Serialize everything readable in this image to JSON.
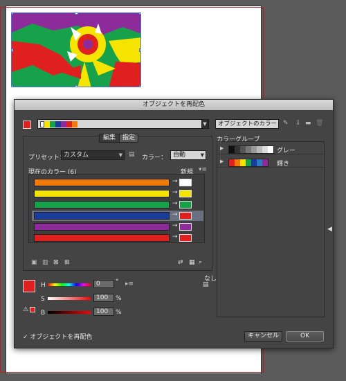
{
  "dialog": {
    "title": "オブジェクトを再配色",
    "color_group_name": "オブジェクトのカラー",
    "color_group_strip": [
      "#ffffff",
      "#f5e400",
      "#17a14a",
      "#1a3c9a",
      "#8e2b9a",
      "#e0201f",
      "#f07a0a"
    ],
    "tabs": {
      "edit": "編集",
      "assign": "指定"
    },
    "preset_label": "プリセット：",
    "preset_value": "カスタム",
    "colors_label": "カラー：",
    "colors_value": "自動",
    "current_colors_label": "現在のカラー (6)",
    "new_label": "新規",
    "rows": [
      {
        "current": "#f07a0a",
        "new": "#ffffff",
        "arrow": "→"
      },
      {
        "current": "#f5e400",
        "new": "#f5e400",
        "arrow": "→"
      },
      {
        "current": "#17a14a",
        "new": "#17a14a",
        "arrow": "→"
      },
      {
        "current": "#1a3c9a",
        "new": "#e0201f",
        "arrow": "→"
      },
      {
        "current": "#8e2b9a",
        "new": "#8e2b9a",
        "arrow": "→"
      },
      {
        "current": "#e0201f",
        "new": "#e0201f",
        "arrow": "→"
      }
    ],
    "color_groups_label": "カラーグループ",
    "groups": [
      {
        "name": "グレー",
        "swatches": [
          "#111111",
          "#333333",
          "#555555",
          "#777777",
          "#999999",
          "#bbbbbb",
          "#dddddd",
          "#ffffff"
        ]
      },
      {
        "name": "輝き",
        "swatches": [
          "#e0201f",
          "#f07a0a",
          "#f5e400",
          "#17a14a",
          "#1a3c9a",
          "#2a7ac0",
          "#8e2b9a"
        ]
      }
    ],
    "sliders": {
      "h_label": "H",
      "h_value": "0",
      "h_unit": "°",
      "s_label": "S",
      "s_value": "100",
      "s_unit": "%",
      "b_label": "B",
      "b_value": "100",
      "b_unit": "%"
    },
    "none_label": "なし",
    "recolor_checkbox_label": "オブジェクトを再配色",
    "cancel_label": "キャンセル",
    "ok_label": "OK",
    "active_color": "#e0201f"
  }
}
